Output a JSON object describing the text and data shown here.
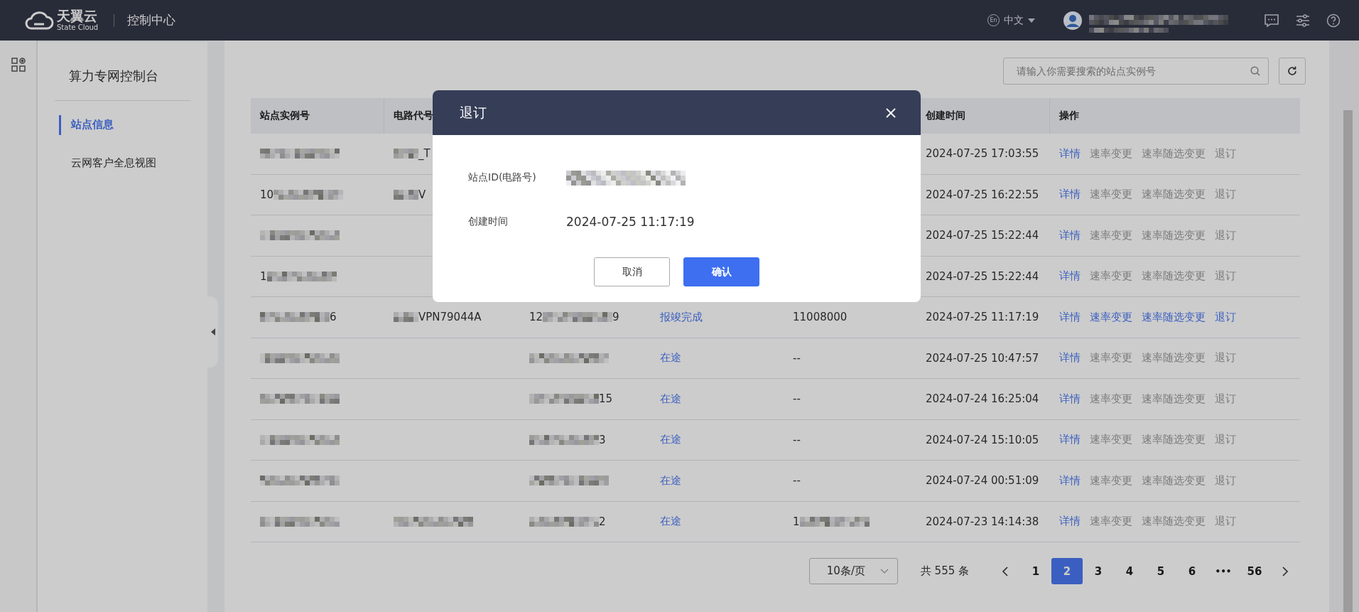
{
  "topbar": {
    "logo_name": "天翼云",
    "logo_sub": "State Cloud",
    "app_title": "控制中心",
    "language_badge": "En",
    "language": "中文",
    "language_menu_expanded": false,
    "user_blurred": true
  },
  "sidebar": {
    "title": "算力专网控制台",
    "items": [
      {
        "label": "站点信息",
        "selected": true
      },
      {
        "label": "云网客户全息视图",
        "selected": false
      }
    ]
  },
  "search": {
    "placeholder": "请输入你需要搜索的站点实例号"
  },
  "table": {
    "columns": [
      "站点实例号",
      "电路代号",
      null,
      null,
      null,
      "创建时间",
      "操作"
    ],
    "rows": [
      {
        "cells": [
          {
            "blurred": true
          },
          {
            "blurred": true,
            "after": "_T"
          },
          null,
          null,
          null
        ],
        "created": "2024-07-25 17:03:55",
        "actions": [
          {
            "label": "详情",
            "disabled": false
          },
          {
            "label": "速率变更",
            "disabled": true
          },
          {
            "label": "速率随选变更",
            "disabled": true
          },
          {
            "label": "退订",
            "disabled": true
          }
        ]
      },
      {
        "cells": [
          {
            "before": "10",
            "blurred": true
          },
          {
            "blurred": true,
            "after": "V"
          },
          null,
          null,
          null
        ],
        "created": "2024-07-25 16:22:55",
        "actions": [
          {
            "label": "详情",
            "disabled": false
          },
          {
            "label": "速率变更",
            "disabled": true
          },
          {
            "label": "速率随选变更",
            "disabled": true
          },
          {
            "label": "退订",
            "disabled": true
          }
        ]
      },
      {
        "cells": [
          {
            "blurred": true
          },
          null,
          null,
          null,
          null
        ],
        "created": "2024-07-25 15:22:44",
        "actions": [
          {
            "label": "详情",
            "disabled": false
          },
          {
            "label": "速率变更",
            "disabled": true
          },
          {
            "label": "速率随选变更",
            "disabled": true
          },
          {
            "label": "退订",
            "disabled": true
          }
        ]
      },
      {
        "cells": [
          {
            "before": "1",
            "blurred": true
          },
          null,
          null,
          null,
          null
        ],
        "created": "2024-07-25 15:22:44",
        "actions": [
          {
            "label": "详情",
            "disabled": false
          },
          {
            "label": "速率变更",
            "disabled": true
          },
          {
            "label": "速率随选变更",
            "disabled": true
          },
          {
            "label": "退订",
            "disabled": true
          }
        ]
      },
      {
        "cells": [
          {
            "blurred": true,
            "after": "6"
          },
          {
            "blurred": true,
            "after": "VPN79044A"
          },
          {
            "before": "12",
            "blurred": true,
            "after": "9"
          },
          {
            "before": "报竣完成",
            "kind": "link"
          },
          {
            "before": "11008000"
          }
        ],
        "created": "2024-07-25 11:17:19",
        "actions": [
          {
            "label": "详情",
            "disabled": false
          },
          {
            "label": "速率变更",
            "disabled": false
          },
          {
            "label": "速率随选变更",
            "disabled": false
          },
          {
            "label": "退订",
            "disabled": false
          }
        ]
      },
      {
        "cells": [
          {
            "blurred": true
          },
          null,
          {
            "blurred": true
          },
          {
            "before": "在途",
            "kind": "link"
          },
          {
            "before": "--"
          }
        ],
        "created": "2024-07-25 10:47:57",
        "actions": [
          {
            "label": "详情",
            "disabled": false
          },
          {
            "label": "速率变更",
            "disabled": true
          },
          {
            "label": "速率随选变更",
            "disabled": true
          },
          {
            "label": "退订",
            "disabled": true
          }
        ]
      },
      {
        "cells": [
          {
            "blurred": true
          },
          null,
          {
            "blurred": true,
            "after": "15"
          },
          {
            "before": "在途",
            "kind": "link"
          },
          {
            "before": "--"
          }
        ],
        "created": "2024-07-24 16:25:04",
        "actions": [
          {
            "label": "详情",
            "disabled": false
          },
          {
            "label": "速率变更",
            "disabled": true
          },
          {
            "label": "速率随选变更",
            "disabled": true
          },
          {
            "label": "退订",
            "disabled": true
          }
        ]
      },
      {
        "cells": [
          {
            "blurred": true
          },
          null,
          {
            "blurred": true,
            "after": "3"
          },
          {
            "before": "在途",
            "kind": "link"
          },
          {
            "before": "--"
          }
        ],
        "created": "2024-07-24 15:10:05",
        "actions": [
          {
            "label": "详情",
            "disabled": false
          },
          {
            "label": "速率变更",
            "disabled": true
          },
          {
            "label": "速率随选变更",
            "disabled": true
          },
          {
            "label": "退订",
            "disabled": true
          }
        ]
      },
      {
        "cells": [
          {
            "blurred": true
          },
          null,
          {
            "blurred": true
          },
          {
            "before": "在途",
            "kind": "link"
          },
          {
            "before": "--"
          }
        ],
        "created": "2024-07-24 00:51:09",
        "actions": [
          {
            "label": "详情",
            "disabled": false
          },
          {
            "label": "速率变更",
            "disabled": true
          },
          {
            "label": "速率随选变更",
            "disabled": true
          },
          {
            "label": "退订",
            "disabled": true
          }
        ]
      },
      {
        "cells": [
          {
            "blurred": true
          },
          {
            "blurred": true
          },
          {
            "blurred": true,
            "after": "2"
          },
          {
            "before": "在途",
            "kind": "link"
          },
          {
            "before": "1",
            "blurred": true
          }
        ],
        "created": "2024-07-23 14:14:38",
        "actions": [
          {
            "label": "详情",
            "disabled": false
          },
          {
            "label": "速率变更",
            "disabled": true
          },
          {
            "label": "速率随选变更",
            "disabled": true
          },
          {
            "label": "退订",
            "disabled": true
          }
        ]
      }
    ]
  },
  "pagination": {
    "page_size": "10条/页",
    "total": "共 555 条",
    "pages": [
      {
        "label": "1",
        "kind": "page",
        "selected": false
      },
      {
        "label": "2",
        "kind": "page",
        "selected": true
      },
      {
        "label": "3",
        "kind": "page",
        "selected": false
      },
      {
        "label": "4",
        "kind": "page",
        "selected": false
      },
      {
        "label": "5",
        "kind": "page",
        "selected": false
      },
      {
        "label": "6",
        "kind": "page",
        "selected": false
      },
      {
        "label": "•••",
        "kind": "ellipsis",
        "selected": false
      },
      {
        "label": "56",
        "kind": "page",
        "selected": false
      }
    ]
  },
  "modal": {
    "title": "退订",
    "fields": [
      {
        "label": "站点ID(电路号)",
        "blurred": true
      },
      {
        "label": "创建时间",
        "value": "2024-07-25 11:17:19"
      }
    ],
    "buttons": [
      {
        "label": "取消",
        "kind": "secondary"
      },
      {
        "label": "确认",
        "kind": "primary"
      }
    ]
  }
}
